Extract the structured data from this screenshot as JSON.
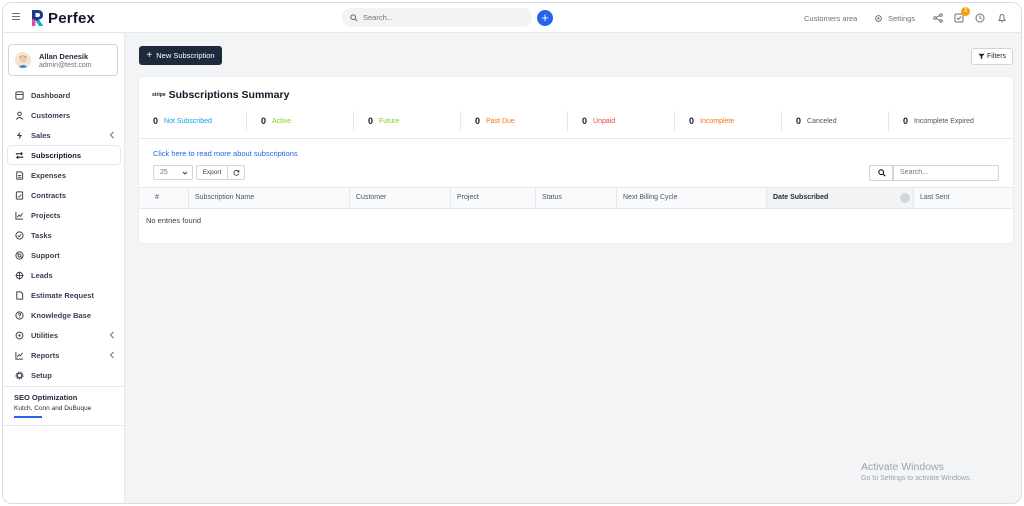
{
  "app": {
    "name": "Perfex"
  },
  "header": {
    "search_placeholder": "Search...",
    "customers_area": "Customers area",
    "settings": "Settings",
    "todo_count": "3"
  },
  "user": {
    "name": "Allan Denesik",
    "email": "admin@test.com"
  },
  "sidebar": {
    "items": [
      {
        "label": "Dashboard",
        "icon": "home-icon"
      },
      {
        "label": "Customers",
        "icon": "user-icon"
      },
      {
        "label": "Sales",
        "icon": "bolt-icon"
      },
      {
        "label": "Subscriptions",
        "icon": "repeat-icon"
      },
      {
        "label": "Expenses",
        "icon": "file-icon"
      },
      {
        "label": "Contracts",
        "icon": "document-icon"
      },
      {
        "label": "Projects",
        "icon": "chart-icon"
      },
      {
        "label": "Tasks",
        "icon": "check-circle-icon"
      },
      {
        "label": "Support",
        "icon": "lifebuoy-icon"
      },
      {
        "label": "Leads",
        "icon": "target-icon"
      },
      {
        "label": "Estimate Request",
        "icon": "file-icon"
      },
      {
        "label": "Knowledge Base",
        "icon": "question-icon"
      },
      {
        "label": "Utilities",
        "icon": "gear-icon"
      },
      {
        "label": "Reports",
        "icon": "line-chart-icon"
      },
      {
        "label": "Setup",
        "icon": "cog-icon"
      }
    ],
    "project": {
      "title": "SEO Optimization",
      "client": "Kutch, Conn and DuBuque",
      "progress": 0.25
    }
  },
  "toolbar": {
    "new_label": "New Subscription",
    "filters_label": "Filters"
  },
  "summary": {
    "stripe": "stripe",
    "title": "Subscriptions Summary",
    "stats": [
      {
        "count": "0",
        "label": "Not Subscribed",
        "color": "#0ea5e9"
      },
      {
        "count": "0",
        "label": "Active",
        "color": "#84cc16"
      },
      {
        "count": "0",
        "label": "Future",
        "color": "#84cc16"
      },
      {
        "count": "0",
        "label": "Past Due",
        "color": "#f97316"
      },
      {
        "count": "0",
        "label": "Unpaid",
        "color": "#ef4444"
      },
      {
        "count": "0",
        "label": "Incomplete",
        "color": "#f97316"
      },
      {
        "count": "0",
        "label": "Canceled",
        "color": "#4b5563"
      },
      {
        "count": "0",
        "label": "Incomplete Expired",
        "color": "#4b5563"
      }
    ],
    "link": "Click here to read more about subscriptions"
  },
  "table": {
    "page_size": "25",
    "export": "Export",
    "search_placeholder": "Search...",
    "columns": [
      "#",
      "Subscription Name",
      "Customer",
      "Project",
      "Status",
      "Next Billing Cycle",
      "Date Subscribed",
      "Last Sent"
    ],
    "empty": "No entries found"
  },
  "watermark": {
    "line1": "Activate Windows",
    "line2": "Go to Settings to activate Windows."
  }
}
